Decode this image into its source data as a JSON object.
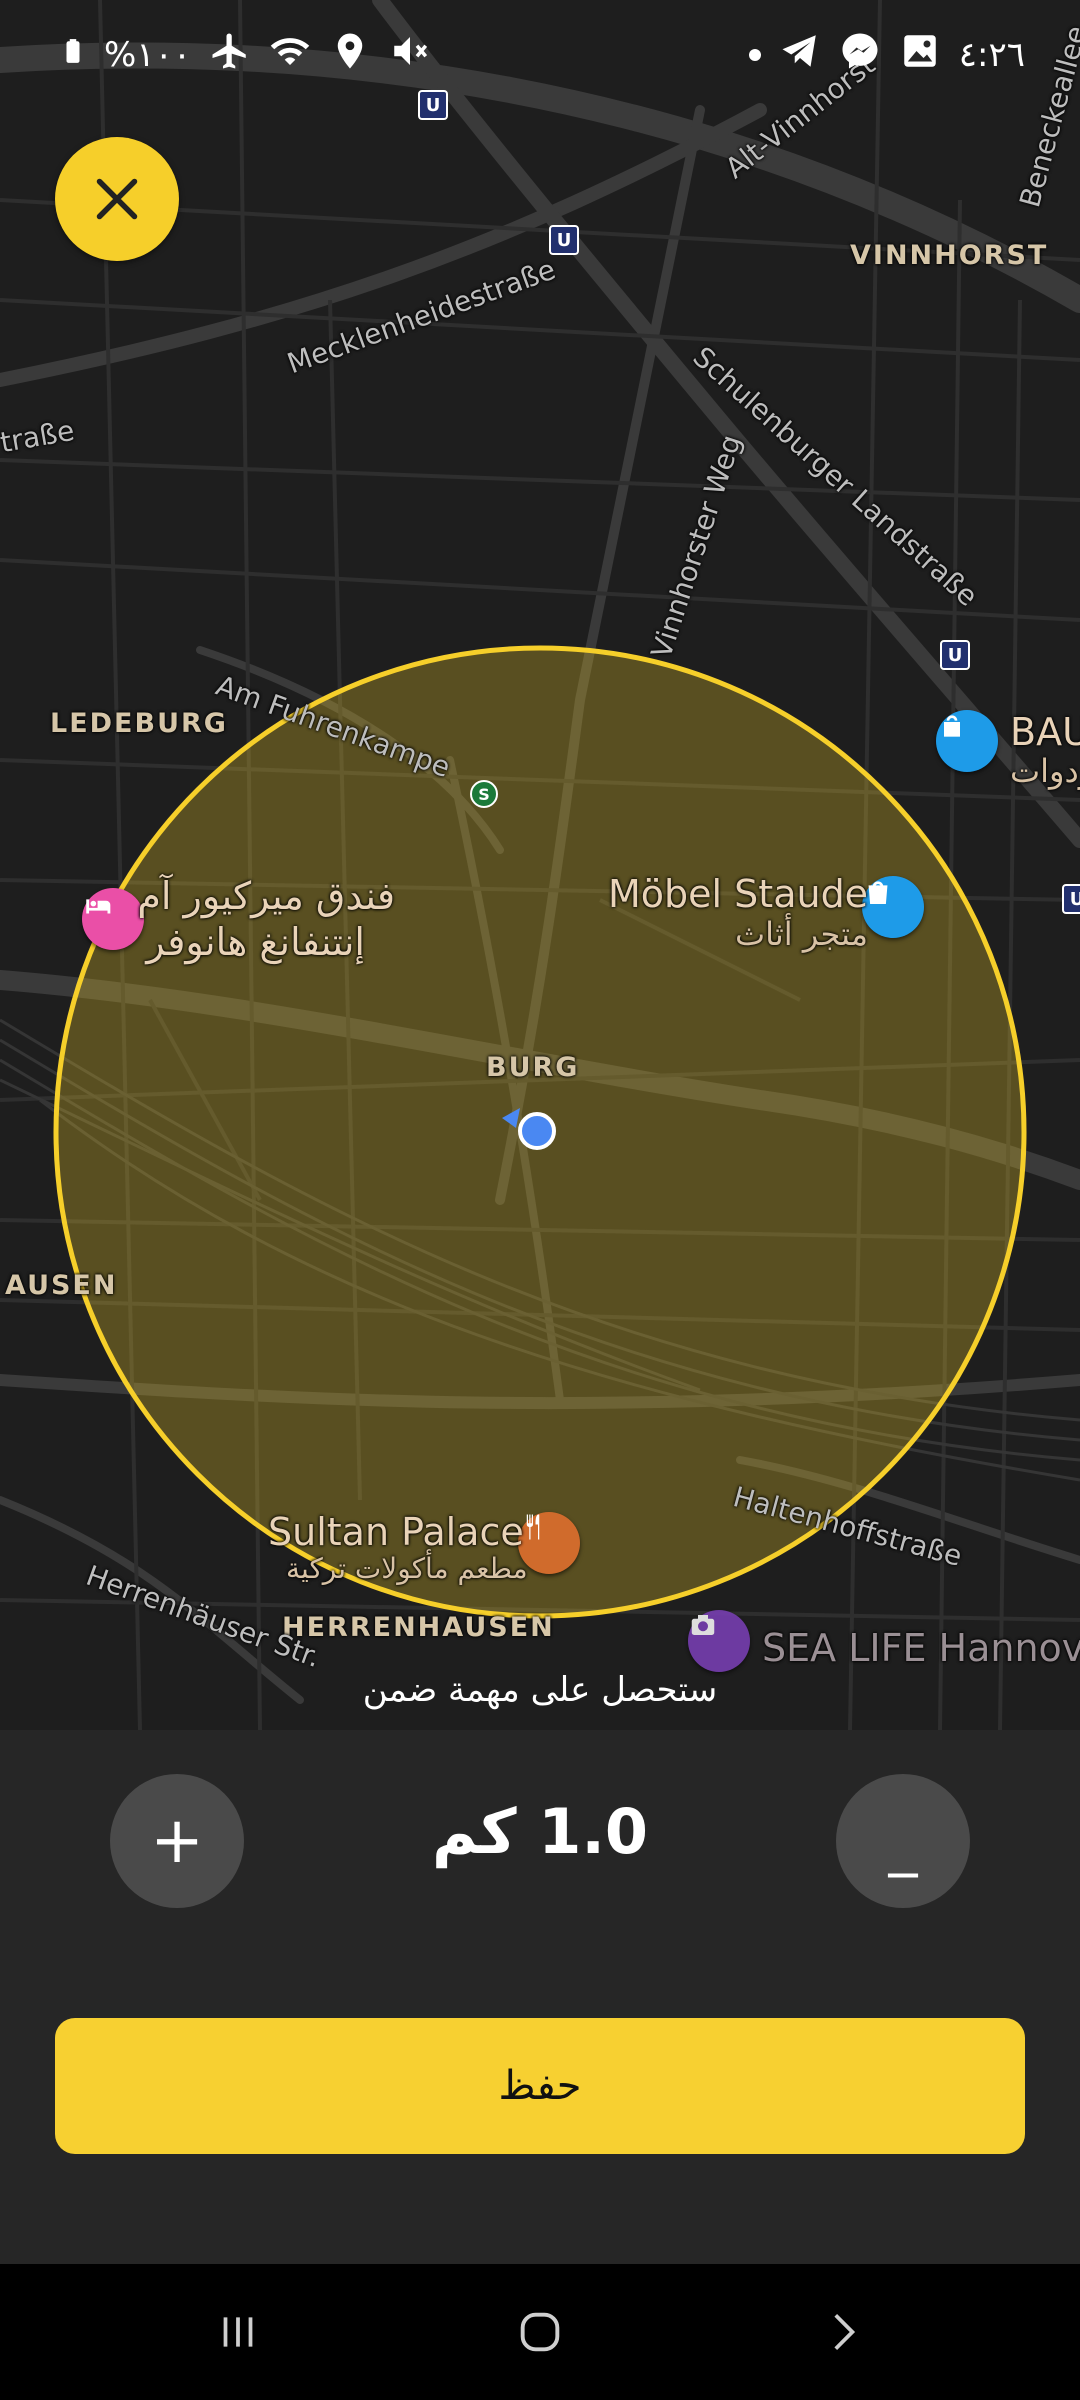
{
  "status_bar": {
    "battery_text": "%١٠٠",
    "time": "٤:٢٦",
    "icons_left": [
      "battery-icon",
      "airplane-icon",
      "wifi-icon",
      "location-icon",
      "mute-icon"
    ],
    "icons_right": [
      "dot-icon",
      "telegram-icon",
      "messenger-icon",
      "gallery-icon"
    ]
  },
  "map": {
    "districts": {
      "vinnhorst": "VINNHORST",
      "ledeburg": "LEDEBURG",
      "burg": "BURG",
      "hausen": "AUSEN",
      "herrenhausen": "HERRENHAUSEN"
    },
    "streets": {
      "mecklenheide": "Mecklenheidestraße",
      "alt_vinnhorst": "Alt-Vinnhorst",
      "beneckeallee": "Beneckeallee",
      "schulenburger": "Schulenburger Landstraße",
      "vinnhorster_weg": "Vinnhorster Weg",
      "am_fuhrenkampe": "Am Fuhrenkampe",
      "strasse_left": "traße",
      "haltenhoff": "Haltenhoffstraße",
      "herrenhaeuser": "Herrenhäuser Str."
    },
    "pois": {
      "hotel_name_line1": "فندق ميركيور آم",
      "hotel_name_line2": "إنتنفانغ هانوفر",
      "moebel_name": "Möbel Staude",
      "moebel_sub": "متجر أثاث",
      "bau_name": "BAU",
      "bau_sub": "ردوات",
      "sultan_name": "Sultan Palace",
      "sultan_sub": "مطعم مأكولات تركية",
      "sealife_name": "SEA LIFE Hannove"
    },
    "transit": {
      "u": "U",
      "s": "S"
    },
    "radius_color": "#f6cf2a"
  },
  "hint": "ستحصل على مهمة ضمن",
  "distance": {
    "value": "1.0",
    "unit": "كم",
    "display": "1.0 كم"
  },
  "buttons": {
    "increase": "+",
    "decrease": "_",
    "save": "حفظ"
  },
  "colors": {
    "accent": "#f7d031",
    "panel": "#262626",
    "button_grey": "#4a4a4a"
  }
}
